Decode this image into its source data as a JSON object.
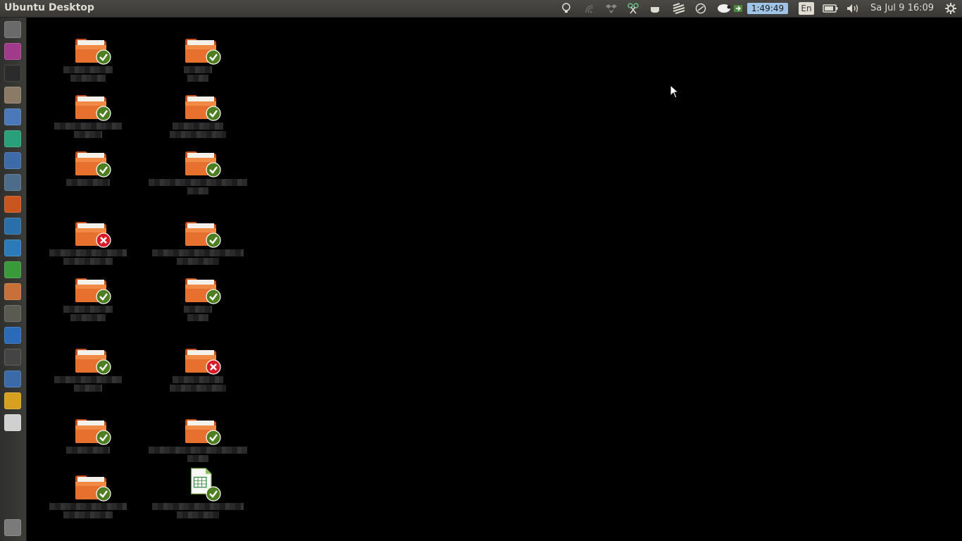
{
  "panel": {
    "title": "Ubuntu Desktop",
    "timer": "1:49:49",
    "language": "En",
    "clock": "Sa Jul 9 16:09"
  },
  "indicators": [
    "lightbulb-icon",
    "signal-icon",
    "dropbox-icon",
    "scissors-icon",
    "coffee-icon",
    "stripes-icon",
    "sync-icon",
    "sheep-icon",
    "network-icon",
    "timer",
    "language",
    "battery-icon",
    "volume-icon",
    "clock",
    "gear-icon"
  ],
  "launcher": {
    "items": [
      {
        "name": "dash-icon",
        "color": "#6a6a6a"
      },
      {
        "name": "media-player-icon",
        "color": "#a03a8a"
      },
      {
        "name": "terminal-icon",
        "color": "#2b2b2b"
      },
      {
        "name": "file-manager-icon",
        "color": "#8a7a66"
      },
      {
        "name": "chromium-icon",
        "color": "#4a78b8"
      },
      {
        "name": "sync-client-icon",
        "color": "#2aa07a"
      },
      {
        "name": "browser-icon",
        "color": "#3d6aa8"
      },
      {
        "name": "image-editor-icon",
        "color": "#4d6c8a"
      },
      {
        "name": "firefox-icon",
        "color": "#c8561e"
      },
      {
        "name": "wordpress-icon",
        "color": "#2a6fa8"
      },
      {
        "name": "writer-icon",
        "color": "#2d7ab8"
      },
      {
        "name": "calc-icon",
        "color": "#3a9a3a"
      },
      {
        "name": "impress-icon",
        "color": "#c8703a"
      },
      {
        "name": "webcam-icon",
        "color": "#5a5a50"
      },
      {
        "name": "gift-icon",
        "color": "#2a6ab8"
      },
      {
        "name": "network-tool-icon",
        "color": "#444444"
      },
      {
        "name": "virtualbox-icon",
        "color": "#3a6aa8"
      },
      {
        "name": "keyring-icon",
        "color": "#d8a020"
      },
      {
        "name": "drive-icon",
        "color": "#d0d0d0"
      },
      {
        "name": "trash-icon",
        "color": "#7a7a7a"
      }
    ]
  },
  "desktop": {
    "icons": [
      {
        "type": "folder",
        "status": "ok"
      },
      {
        "type": "folder",
        "status": "ok"
      },
      {
        "type": "folder",
        "status": "ok"
      },
      {
        "type": "folder",
        "status": "ok"
      },
      {
        "type": "folder",
        "status": "ok"
      },
      {
        "type": "folder",
        "status": "ok"
      },
      {
        "type": "folder",
        "status": "error"
      },
      {
        "type": "folder",
        "status": "ok"
      },
      {
        "type": "folder",
        "status": "ok"
      },
      {
        "type": "folder",
        "status": "ok"
      },
      {
        "type": "folder",
        "status": "ok"
      },
      {
        "type": "folder",
        "status": "error"
      },
      {
        "type": "folder",
        "status": "ok"
      },
      {
        "type": "folder",
        "status": "ok"
      },
      {
        "type": "folder",
        "status": "ok"
      },
      {
        "type": "spreadsheet",
        "status": "ok"
      }
    ]
  },
  "colors": {
    "panel_bg": "#3c3b37",
    "folder_orange": "#e86a2a",
    "emblem_ok": "#5a8a2a",
    "emblem_error": "#d81c2a",
    "timer_bg": "#9fc4e8"
  }
}
